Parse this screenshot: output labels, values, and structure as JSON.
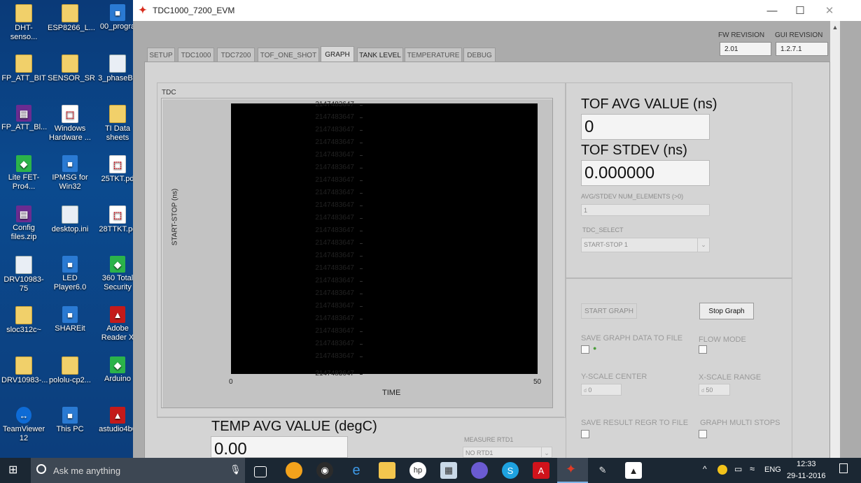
{
  "desktop": {
    "icons": [
      {
        "label": "DHT-senso...",
        "type": "folder"
      },
      {
        "label": "ESP8266_L...",
        "type": "folder"
      },
      {
        "label": "00_progra",
        "type": "app"
      },
      {
        "label": "FP_ATT_BIT",
        "type": "folder"
      },
      {
        "label": "SENSOR_SR",
        "type": "folder"
      },
      {
        "label": "3_phaseBo",
        "type": "file"
      },
      {
        "label": "FP_ATT_Bl...",
        "type": "purple"
      },
      {
        "label": "Windows Hardware ...",
        "type": "pdf"
      },
      {
        "label": "TI Data sheets",
        "type": "folder"
      },
      {
        "label": "Lite FET-Pro4...",
        "type": "green"
      },
      {
        "label": "IPMSG for Win32",
        "type": "app"
      },
      {
        "label": "25TKT.pd",
        "type": "pdf"
      },
      {
        "label": "Config files.zip",
        "type": "purple"
      },
      {
        "label": "desktop.ini",
        "type": "file"
      },
      {
        "label": "28TTKT.pc",
        "type": "pdf"
      },
      {
        "label": "DRV10983-75",
        "type": "file"
      },
      {
        "label": "LED Player6.0",
        "type": "app"
      },
      {
        "label": "360 Total Security",
        "type": "green"
      },
      {
        "label": "sloc312c~",
        "type": "folder"
      },
      {
        "label": "SHAREit",
        "type": "app"
      },
      {
        "label": "Adobe Reader X",
        "type": "red"
      },
      {
        "label": "DRV10983-...",
        "type": "folder"
      },
      {
        "label": "pololu-cp2...",
        "type": "folder"
      },
      {
        "label": "Arduino",
        "type": "green"
      },
      {
        "label": "TeamViewer 12",
        "type": "tv"
      },
      {
        "label": "This PC",
        "type": "app"
      },
      {
        "label": "astudio4b6",
        "type": "red"
      }
    ]
  },
  "window": {
    "title": "TDC1000_7200_EVM",
    "controls": {
      "minimize": "—",
      "maximize": "☐",
      "close": "✕"
    }
  },
  "tabs": [
    {
      "label": "SETUP"
    },
    {
      "label": "TDC1000"
    },
    {
      "label": "TDC7200"
    },
    {
      "label": "TOF_ONE_SHOT"
    },
    {
      "label": "GRAPH"
    },
    {
      "label": "TANK LEVEL"
    },
    {
      "label": "TEMPERATURE"
    },
    {
      "label": "DEBUG"
    }
  ],
  "revision": {
    "fw_label": "FW REVISION",
    "fw_value": "2.01",
    "gui_label": "GUI REVISION",
    "gui_value": "1.2.7.1"
  },
  "graph": {
    "section_label": "TDC",
    "ylabel": "START-STOP (ns)",
    "xlabel": "TIME",
    "x_min": "0",
    "x_max": "50"
  },
  "chart_data": {
    "type": "line",
    "title": "",
    "xlabel": "TIME",
    "ylabel": "START-STOP (ns)",
    "xlim": [
      0,
      50
    ],
    "y_tick_labels": [
      "2147483647",
      "2147483647",
      "2147483647",
      "2147483647",
      "2147483647",
      "2147483647",
      "2147483647",
      "2147483647",
      "2147483647",
      "2147483647",
      "2147483647",
      "2147483647",
      "2147483647",
      "2147483647",
      "2147483647",
      "2147483647",
      "2147483647",
      "2147483647",
      "2147483647",
      "2147483647",
      "2147483647",
      "2147483647"
    ],
    "series": []
  },
  "tof": {
    "avg_title": "TOF AVG VALUE (ns)",
    "avg_value": "0",
    "stdev_title": "TOF STDEV (ns)",
    "stdev_value": "0.000000",
    "num_elements_label": "AVG/STDEV NUM_ELEMENTS (>0)",
    "num_elements_value": "1",
    "tdc_select_label": "TDC_SELECT",
    "tdc_select_value": "START-STOP 1"
  },
  "controls": {
    "start_graph": "START GRAPH",
    "stop_graph": "Stop Graph",
    "save_graph_label": "SAVE GRAPH DATA TO FILE",
    "flow_mode_label": "FLOW MODE",
    "y_scale_label": "Y-SCALE CENTER",
    "y_scale_value": "0",
    "x_scale_label": "X-SCALE RANGE",
    "x_scale_value": "50",
    "save_result_label": "SAVE RESULT REGR TO FILE",
    "graph_multi_label": "GRAPH MULTI STOPS"
  },
  "temp": {
    "avg_title": "TEMP AVG VALUE (degC)",
    "avg_value": "0.00",
    "measure_label": "MEASURE RTD1",
    "measure_value": "NO RTD1"
  },
  "taskbar": {
    "search_placeholder": "Ask me anything",
    "language": "ENG",
    "time": "12:33",
    "date": "29-11-2016"
  }
}
